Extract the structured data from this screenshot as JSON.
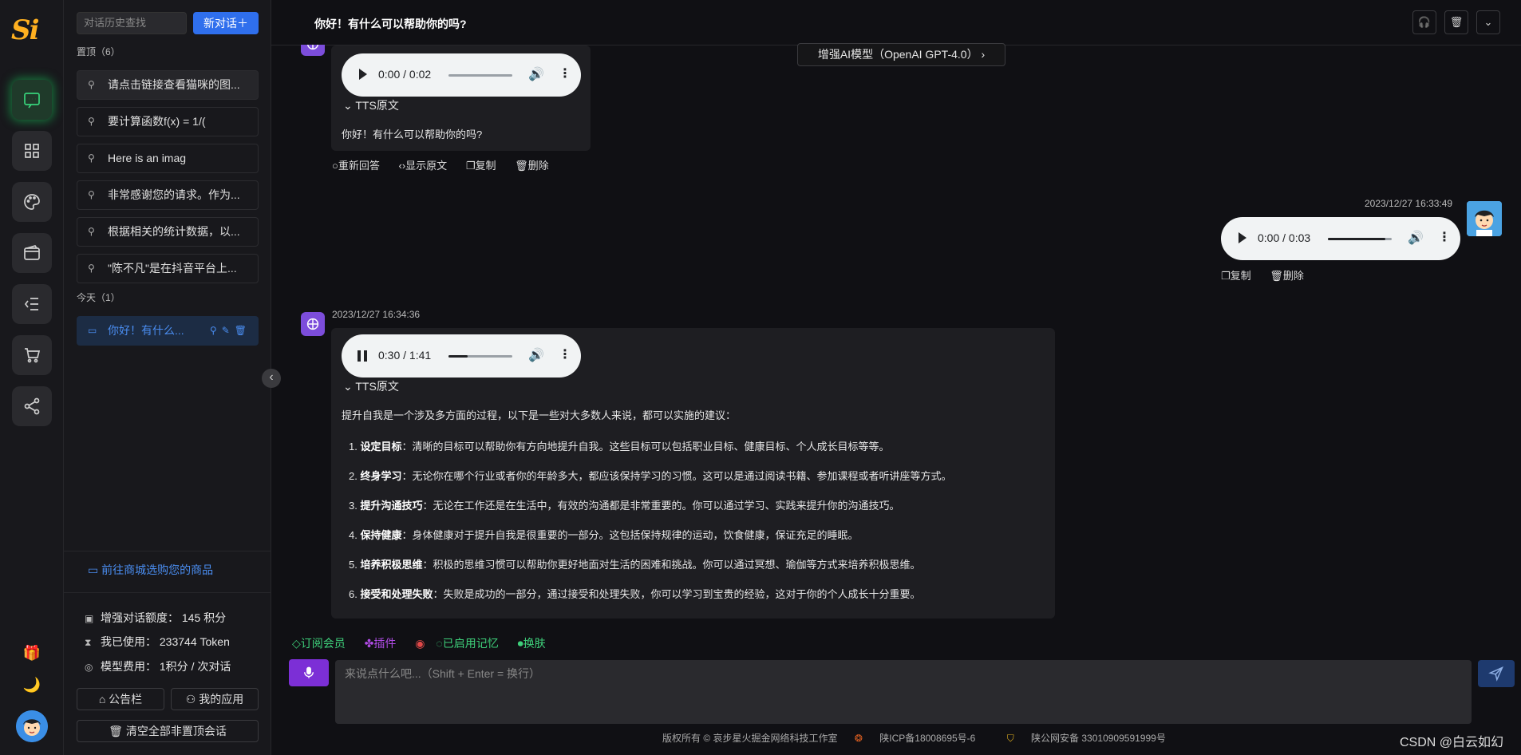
{
  "rail": {
    "logo_a": "S",
    "logo_b": "i",
    "items": [
      {
        "name": "chat",
        "icon": "chat-icon",
        "active": true
      },
      {
        "name": "apps",
        "icon": "grid-icon"
      },
      {
        "name": "draw",
        "icon": "palette-icon"
      },
      {
        "name": "wallet",
        "icon": "wallet-icon"
      },
      {
        "name": "list",
        "icon": "list-icon"
      },
      {
        "name": "shop",
        "icon": "cart-icon"
      },
      {
        "name": "share",
        "icon": "share-icon"
      }
    ],
    "gift_icon": "🎁",
    "moon_icon": "🌙"
  },
  "history": {
    "search_placeholder": "对话历史查找",
    "new_chat": "新对话＋",
    "pinned_label": "置顶（6）",
    "pinned": [
      "请点击链接查看猫咪的图...",
      "要计算函数f(x) = 1/(",
      "Here is an imag",
      "非常感谢您的请求。作为...",
      "根据相关的统计数据，以...",
      "\"陈不凡\"是在抖音平台上..."
    ],
    "today_label": "今天（1）",
    "today": [
      "你好！有什么..."
    ],
    "shop_link": "前往商城选购您的商品",
    "stats": {
      "balance": "增强对话额度：  145 积分",
      "used": "我已使用：  233744 Token",
      "fee": "模型费用：  1积分 / 次对话"
    },
    "notice_btn": "公告栏",
    "apps_btn": "我的应用",
    "clear_btn": "清空全部非置顶会话"
  },
  "header": {
    "title": "你好！有什么可以帮助你的吗?",
    "model": "增强AI模型（OpenAI GPT-4.0）"
  },
  "messages": {
    "bot1": {
      "audio_time": "0:00 / 0:02",
      "audio_progress": 0,
      "tts_label": "TTS原文",
      "text": "你好！有什么可以帮助你的吗?",
      "actions": [
        "重新回答",
        "显示原文",
        "复制",
        "删除"
      ]
    },
    "user1": {
      "time": "2023/12/27 16:33:49",
      "audio_time": "0:00 / 0:03",
      "audio_progress": 0.9,
      "actions": [
        "复制",
        "删除"
      ]
    },
    "bot2": {
      "time": "2023/12/27 16:34:36",
      "audio_time": "0:30 / 1:41",
      "audio_progress": 0.3,
      "tts_label": "TTS原文",
      "intro": "提升自我是一个涉及多方面的过程，以下是一些对大多数人来说，都可以实施的建议：",
      "items": [
        {
          "title": "设定目标",
          "text": "：清晰的目标可以帮助你有方向地提升自我。这些目标可以包括职业目标、健康目标、个人成长目标等等。"
        },
        {
          "title": "终身学习",
          "text": "：无论你在哪个行业或者你的年龄多大，都应该保持学习的习惯。这可以是通过阅读书籍、参加课程或者听讲座等方式。"
        },
        {
          "title": "提升沟通技巧",
          "text": "：无论在工作还是在生活中，有效的沟通都是非常重要的。你可以通过学习、实践来提升你的沟通技巧。"
        },
        {
          "title": "保持健康",
          "text": "：身体健康对于提升自我是很重要的一部分。这包括保持规律的运动，饮食健康，保证充足的睡眠。"
        },
        {
          "title": "培养积极思维",
          "text": "：积极的思维习惯可以帮助你更好地面对生活的困难和挑战。你可以通过冥想、瑜伽等方式来培养积极思维。"
        },
        {
          "title": "接受和处理失败",
          "text": "：失败是成功的一部分，通过接受和处理失败，你可以学习到宝贵的经验，这对于你的个人成长十分重要。"
        }
      ]
    }
  },
  "tools": {
    "subscribe": "订阅会员",
    "plugin": "插件",
    "memory": "已启用记忆",
    "skin": "换肤"
  },
  "input": {
    "placeholder": "来说点什么吧...（Shift + Enter = 换行）"
  },
  "footer": {
    "copyright": "版权所有 © 哀步星火掘金网络科技工作室",
    "icp": "陕ICP备18008695号-6",
    "police": "陕公网安备 33010909591999号"
  },
  "watermark": "CSDN @白云如幻",
  "colors": {
    "accent": "#2f6fed",
    "rail_active": "#38d27a",
    "bot_avatar": "#7c4ddb",
    "mic": "#7c2fd6",
    "tool_green": "#3ecf7a",
    "tool_purple": "#b04ce6",
    "tool_red": "#e04848"
  }
}
